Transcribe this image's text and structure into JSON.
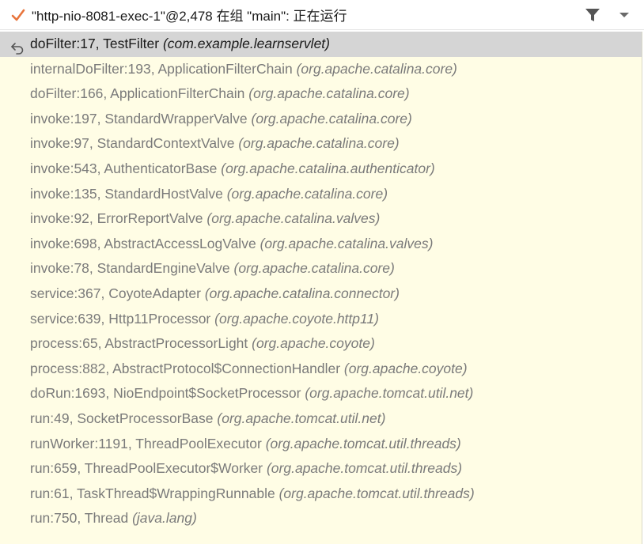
{
  "header": {
    "thread_title": "\"http-nio-8081-exec-1\"@2,478 在组 \"main\": 正在运行",
    "status_icon": "check-icon",
    "filter_icon": "filter-icon",
    "menu_icon": "chevron-down-icon",
    "accent_color": "#e8743b"
  },
  "frames": [
    {
      "method": "doFilter:17, TestFilter",
      "pkg": "(com.example.learnservlet)",
      "selected": true
    },
    {
      "method": "internalDoFilter:193, ApplicationFilterChain",
      "pkg": "(org.apache.catalina.core)"
    },
    {
      "method": "doFilter:166, ApplicationFilterChain",
      "pkg": "(org.apache.catalina.core)"
    },
    {
      "method": "invoke:197, StandardWrapperValve",
      "pkg": "(org.apache.catalina.core)"
    },
    {
      "method": "invoke:97, StandardContextValve",
      "pkg": "(org.apache.catalina.core)"
    },
    {
      "method": "invoke:543, AuthenticatorBase",
      "pkg": "(org.apache.catalina.authenticator)"
    },
    {
      "method": "invoke:135, StandardHostValve",
      "pkg": "(org.apache.catalina.core)"
    },
    {
      "method": "invoke:92, ErrorReportValve",
      "pkg": "(org.apache.catalina.valves)"
    },
    {
      "method": "invoke:698, AbstractAccessLogValve",
      "pkg": "(org.apache.catalina.valves)"
    },
    {
      "method": "invoke:78, StandardEngineValve",
      "pkg": "(org.apache.catalina.core)"
    },
    {
      "method": "service:367, CoyoteAdapter",
      "pkg": "(org.apache.catalina.connector)"
    },
    {
      "method": "service:639, Http11Processor",
      "pkg": "(org.apache.coyote.http11)"
    },
    {
      "method": "process:65, AbstractProcessorLight",
      "pkg": "(org.apache.coyote)"
    },
    {
      "method": "process:882, AbstractProtocol$ConnectionHandler",
      "pkg": "(org.apache.coyote)"
    },
    {
      "method": "doRun:1693, NioEndpoint$SocketProcessor",
      "pkg": "(org.apache.tomcat.util.net)"
    },
    {
      "method": "run:49, SocketProcessorBase",
      "pkg": "(org.apache.tomcat.util.net)"
    },
    {
      "method": "runWorker:1191, ThreadPoolExecutor",
      "pkg": "(org.apache.tomcat.util.threads)"
    },
    {
      "method": "run:659, ThreadPoolExecutor$Worker",
      "pkg": "(org.apache.tomcat.util.threads)"
    },
    {
      "method": "run:61, TaskThread$WrappingRunnable",
      "pkg": "(org.apache.tomcat.util.threads)"
    },
    {
      "method": "run:750, Thread",
      "pkg": "(java.lang)"
    }
  ]
}
